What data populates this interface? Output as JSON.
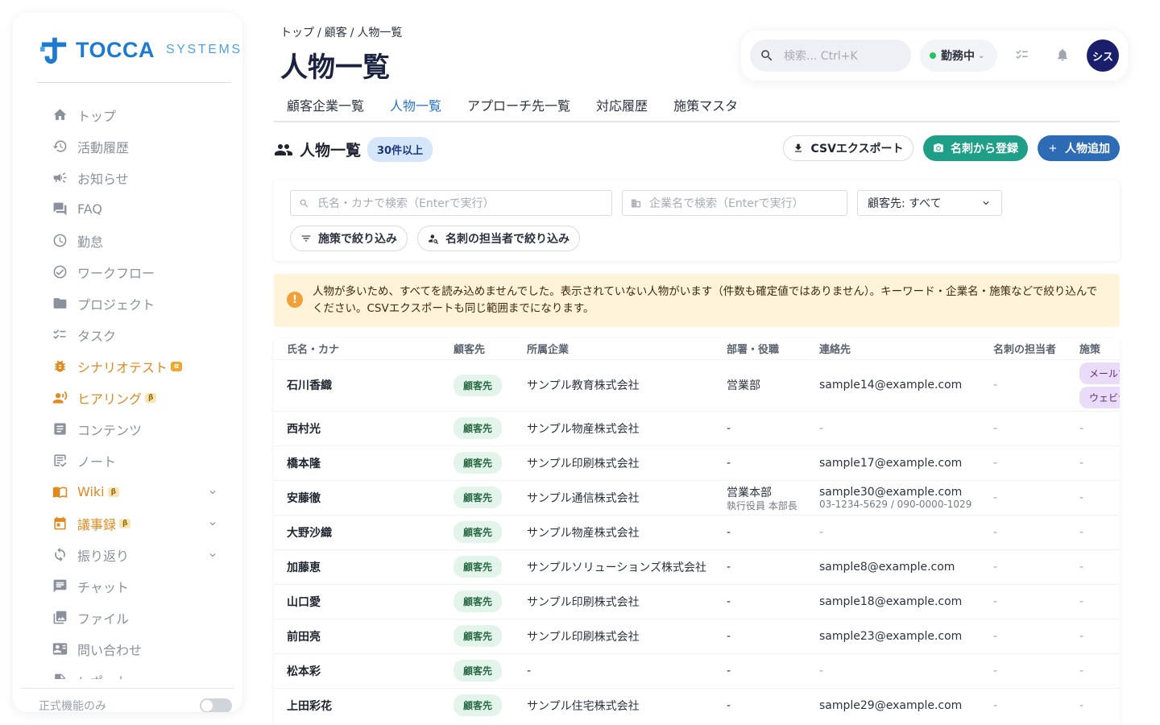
{
  "app": {
    "logo_text": "TOCCA",
    "logo_sub": "SYSTEMS"
  },
  "sidebar": {
    "items": [
      {
        "label": "トップ",
        "icon": "home-icon",
        "accent": false
      },
      {
        "label": "活動履歴",
        "icon": "history-icon",
        "accent": false
      },
      {
        "label": "お知らせ",
        "icon": "megaphone-icon",
        "accent": false
      },
      {
        "label": "FAQ",
        "icon": "forum-icon",
        "accent": false
      },
      {
        "label": "勤怠",
        "icon": "clock-icon",
        "accent": false
      },
      {
        "label": "ワークフロー",
        "icon": "check-circle-icon",
        "accent": false
      },
      {
        "label": "プロジェクト",
        "icon": "folder-icon",
        "accent": false
      },
      {
        "label": "タスク",
        "icon": "checklist-icon",
        "accent": false
      },
      {
        "label": "シナリオテスト",
        "icon": "bug-icon",
        "accent": true,
        "badge": "α"
      },
      {
        "label": "ヒアリング",
        "icon": "interview-icon",
        "accent": true,
        "badge": "β"
      },
      {
        "label": "コンテンツ",
        "icon": "article-icon",
        "accent": false
      },
      {
        "label": "ノート",
        "icon": "note-icon",
        "accent": false
      },
      {
        "label": "Wiki",
        "icon": "book-icon",
        "accent": true,
        "badge": "β",
        "expandable": true
      },
      {
        "label": "議事録",
        "icon": "calendar-icon",
        "accent": true,
        "badge": "β",
        "expandable": true
      },
      {
        "label": "振り返り",
        "icon": "refresh-icon",
        "accent": false,
        "expandable": true
      },
      {
        "label": "チャット",
        "icon": "chat-icon",
        "accent": false
      },
      {
        "label": "ファイル",
        "icon": "image-icon",
        "accent": false
      },
      {
        "label": "問い合わせ",
        "icon": "contact-card-icon",
        "accent": false
      },
      {
        "label": "レポート",
        "icon": "report-icon",
        "accent": false
      }
    ],
    "footer_label": "正式機能のみ",
    "footer_toggle_on": false
  },
  "header": {
    "breadcrumb": [
      "トップ",
      "顧客",
      "人物一覧"
    ],
    "breadcrumb_sep": "/",
    "title": "人物一覧",
    "search_placeholder": "検索... Ctrl+K",
    "status_label": "勤務中",
    "status_color": "#22c55e",
    "avatar_text": "シス"
  },
  "tabs": [
    {
      "label": "顧客企業一覧",
      "active": false
    },
    {
      "label": "人物一覧",
      "active": true
    },
    {
      "label": "アプローチ先一覧",
      "active": false
    },
    {
      "label": "対応履歴",
      "active": false
    },
    {
      "label": "施策マスタ",
      "active": false
    }
  ],
  "section": {
    "title": "人物一覧",
    "count_badge": "30件以上",
    "csv_button": "CSVエクスポート",
    "card_button": "名刺から登録",
    "add_button": "人物追加"
  },
  "filters": {
    "name_placeholder": "氏名・カナで検索（Enterで実行）",
    "company_placeholder": "企業名で検索（Enterで実行）",
    "customer_select": "顧客先: すべて",
    "measure_chip": "施策で絞り込み",
    "owner_chip": "名刺の担当者で絞り込み"
  },
  "warning": {
    "icon": "!",
    "text": "人物が多いため、すべてを読み込めませんでした。表示されていない人物がいます（件数も確定値ではありません）。キーワード・企業名・施策などで絞り込んでください。CSVエクスポートも同じ範囲までになります。"
  },
  "table": {
    "columns": [
      "氏名・カナ",
      "顧客先",
      "所属企業",
      "部署・役職",
      "連絡先",
      "名刺の担当者",
      "施策"
    ],
    "rows": [
      {
        "name": "石川香織",
        "customer": "顧客先",
        "company": "サンプル教育株式会社",
        "dept": "営業部",
        "dept_sub": "",
        "contact": "sample14@example.com",
        "contact_sub": "",
        "owner": "-",
        "measures": [
          "メールマガジン",
          "ウェビナー"
        ]
      },
      {
        "name": "西村光",
        "customer": "顧客先",
        "company": "サンプル物産株式会社",
        "dept": "-",
        "dept_sub": "",
        "contact": "-",
        "contact_sub": "",
        "owner": "-",
        "measures_text": "-"
      },
      {
        "name": "橋本隆",
        "customer": "顧客先",
        "company": "サンプル印刷株式会社",
        "dept": "-",
        "dept_sub": "",
        "contact": "sample17@example.com",
        "contact_sub": "",
        "owner": "-",
        "measures_text": "-"
      },
      {
        "name": "安藤徹",
        "customer": "顧客先",
        "company": "サンプル通信株式会社",
        "dept": "営業本部",
        "dept_sub": "執行役員 本部長",
        "contact": "sample30@example.com",
        "contact_sub": "03-1234-5629 / 090-0000-1029",
        "owner": "-",
        "measures_text": "-"
      },
      {
        "name": "大野沙織",
        "customer": "顧客先",
        "company": "サンプル物産株式会社",
        "dept": "-",
        "dept_sub": "",
        "contact": "-",
        "contact_sub": "",
        "owner": "-",
        "measures_text": "-"
      },
      {
        "name": "加藤恵",
        "customer": "顧客先",
        "company": "サンプルソリューションズ株式会社",
        "dept": "-",
        "dept_sub": "",
        "contact": "sample8@example.com",
        "contact_sub": "",
        "owner": "-",
        "measures_text": "-"
      },
      {
        "name": "山口愛",
        "customer": "顧客先",
        "company": "サンプル印刷株式会社",
        "dept": "-",
        "dept_sub": "",
        "contact": "sample18@example.com",
        "contact_sub": "",
        "owner": "-",
        "measures_text": "-"
      },
      {
        "name": "前田亮",
        "customer": "顧客先",
        "company": "サンプル印刷株式会社",
        "dept": "-",
        "dept_sub": "",
        "contact": "sample23@example.com",
        "contact_sub": "",
        "owner": "-",
        "measures_text": "-"
      },
      {
        "name": "松本彩",
        "customer": "顧客先",
        "company": "-",
        "dept": "-",
        "dept_sub": "",
        "contact": "-",
        "contact_sub": "",
        "owner": "-",
        "measures_text": "-"
      },
      {
        "name": "上田彩花",
        "customer": "顧客先",
        "company": "サンプル住宅株式会社",
        "dept": "-",
        "dept_sub": "",
        "contact": "sample29@example.com",
        "contact_sub": "",
        "owner": "-",
        "measures_text": "-"
      }
    ]
  }
}
